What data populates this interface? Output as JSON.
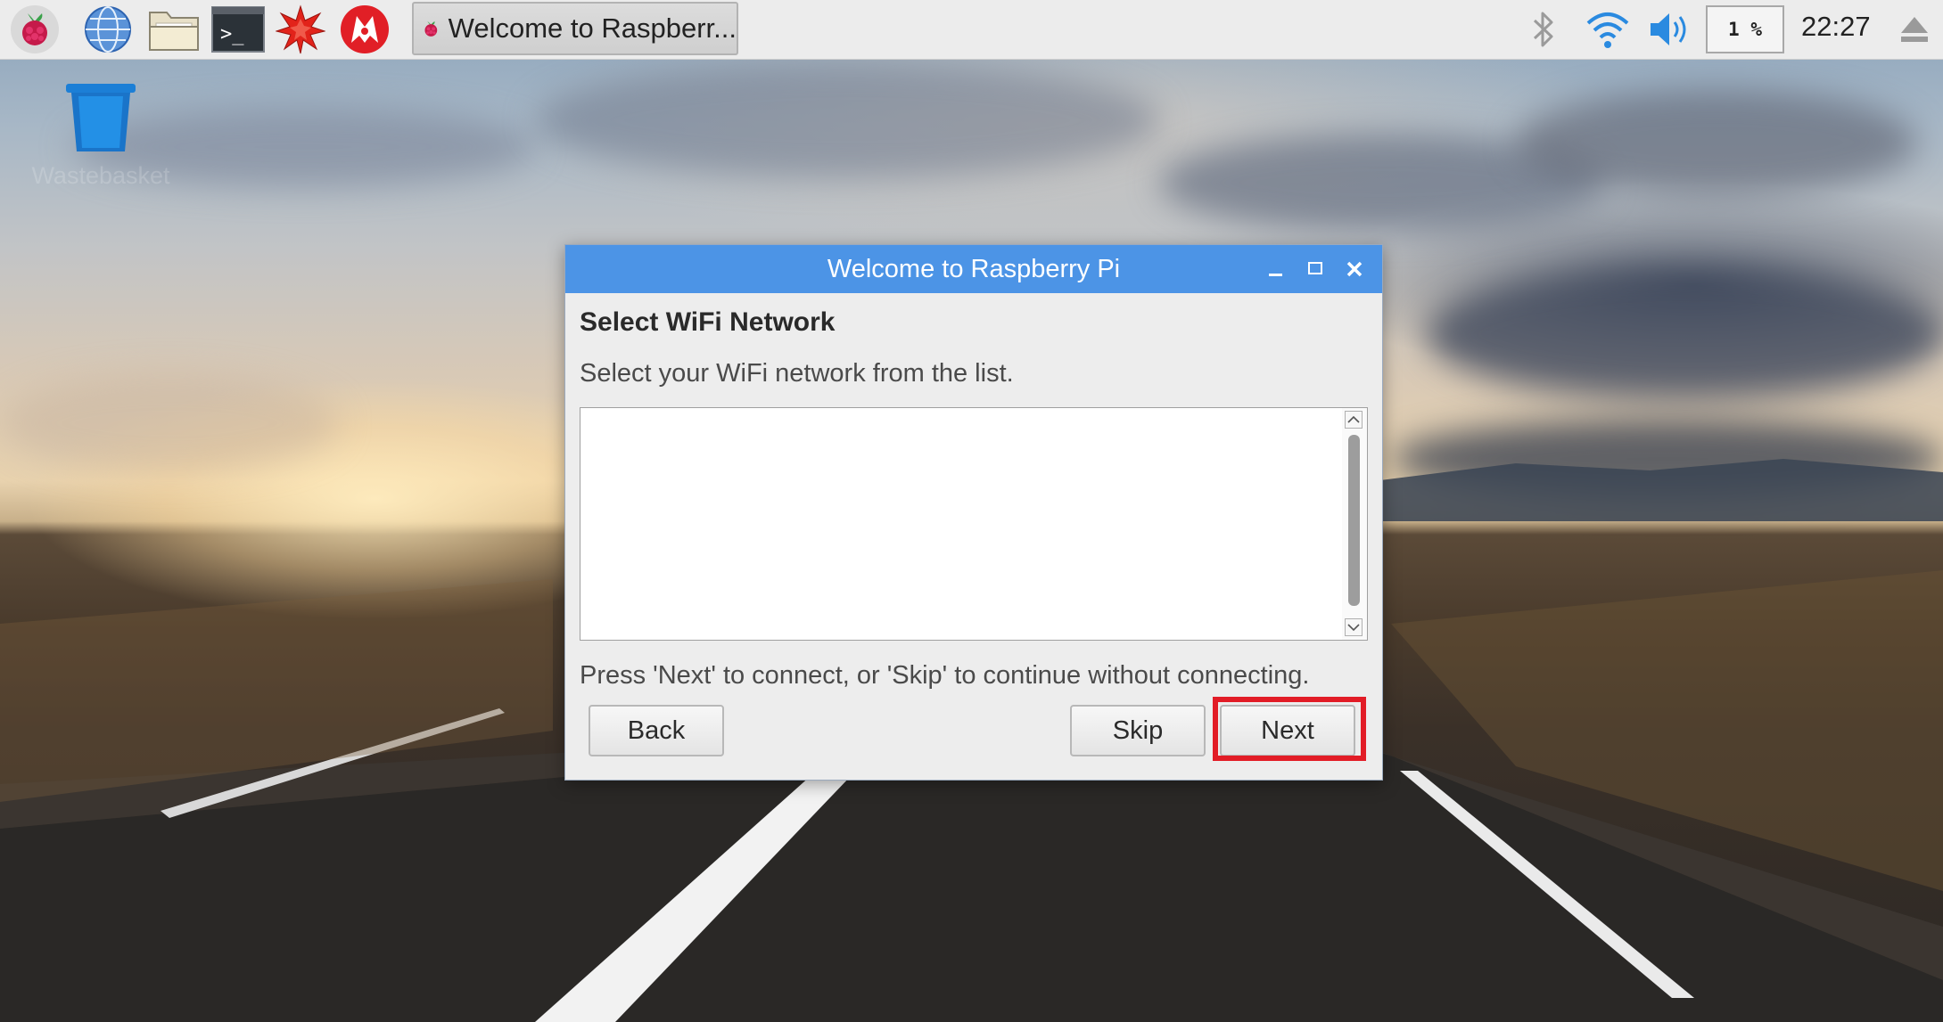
{
  "taskbar": {
    "window_button_label": "Welcome to Raspberr...",
    "cpu_label": "1 %",
    "clock": "22:27",
    "launchers": [
      "raspberry-menu-icon",
      "web-browser-icon",
      "file-manager-icon",
      "terminal-icon",
      "mathematica-icon",
      "wolfram-icon"
    ],
    "tray_icons": [
      "bluetooth-icon",
      "wifi-icon",
      "volume-icon",
      "eject-icon"
    ]
  },
  "desktop": {
    "wastebasket_label": "Wastebasket"
  },
  "dialog": {
    "title": "Welcome to Raspberry Pi",
    "heading": "Select WiFi Network",
    "description": "Select your WiFi network from the list.",
    "networks": [],
    "hint": "Press 'Next' to connect, or 'Skip' to continue without connecting.",
    "back_label": "Back",
    "skip_label": "Skip",
    "next_label": "Next"
  },
  "colors": {
    "titlebar": "#4c94e6",
    "highlight": "#e21c26",
    "panel": "#ececec"
  }
}
